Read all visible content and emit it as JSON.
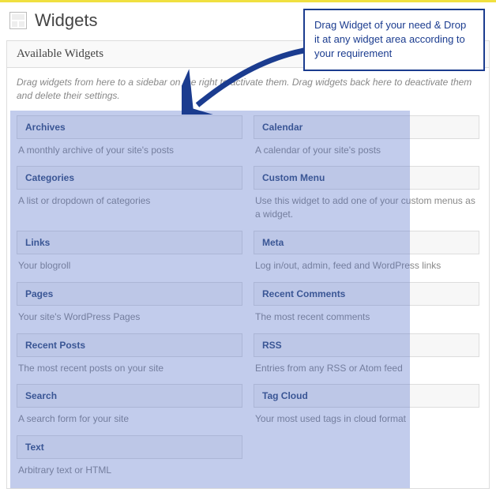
{
  "page": {
    "title": "Widgets"
  },
  "panel": {
    "header": "Available Widgets",
    "instructions": "Drag widgets from here to a sidebar on the right to activate them. Drag widgets back here to deactivate them and delete their settings."
  },
  "callout": {
    "text": "Drag Widget of your need & Drop it at any widget area according to your requirement"
  },
  "widgets": [
    {
      "title": "Archives",
      "desc": "A monthly archive of your site's posts"
    },
    {
      "title": "Calendar",
      "desc": "A calendar of your site's posts"
    },
    {
      "title": "Categories",
      "desc": "A list or dropdown of categories"
    },
    {
      "title": "Custom Menu",
      "desc": "Use this widget to add one of your custom menus as a widget."
    },
    {
      "title": "Links",
      "desc": "Your blogroll"
    },
    {
      "title": "Meta",
      "desc": "Log in/out, admin, feed and WordPress links"
    },
    {
      "title": "Pages",
      "desc": "Your site's WordPress Pages"
    },
    {
      "title": "Recent Comments",
      "desc": "The most recent comments"
    },
    {
      "title": "Recent Posts",
      "desc": "The most recent posts on your site"
    },
    {
      "title": "RSS",
      "desc": "Entries from any RSS or Atom feed"
    },
    {
      "title": "Search",
      "desc": "A search form for your site"
    },
    {
      "title": "Tag Cloud",
      "desc": "Your most used tags in cloud format"
    },
    {
      "title": "Text",
      "desc": "Arbitrary text or HTML"
    }
  ]
}
